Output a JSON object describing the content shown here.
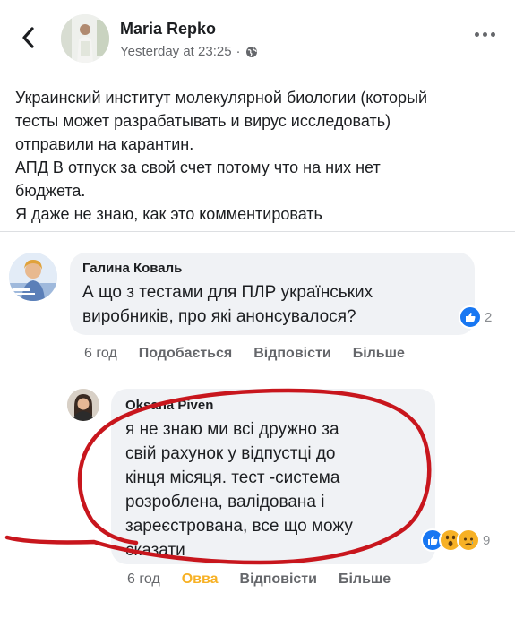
{
  "post": {
    "author": "Maria Repko",
    "time": "Yesterday at 23:25",
    "separator": "·",
    "text_lines": [
      "Украинский институт молекулярной биологии (который",
      "тесты может разрабатывать и вирус исследовать)",
      "отправили на карантин.",
      "АПД В отпуск за свой счет потому что на них нет",
      "бюджета.",
      "Я даже не знаю, как это комментировать"
    ]
  },
  "comments": [
    {
      "author": "Галина Коваль",
      "text_lines": [
        "А що з тестами для ПЛР українських",
        "виробників, про які анонсувалося?"
      ],
      "reaction_count": "2",
      "time": "6 год",
      "like": "Подобається",
      "reply": "Відповісти",
      "more": "Більше"
    },
    {
      "author": "Oksana Piven",
      "text_lines": [
        "я не знаю ми всі дружно за",
        "свій рахунок у відпустці до",
        "кінця місяця. тест -система",
        "розроблена, валідована і",
        "зареєстрована, все що можу",
        "сказати"
      ],
      "reaction_count": "9",
      "time": "6 год",
      "like": "Овва",
      "reply": "Відповісти",
      "more": "Більше"
    }
  ],
  "icons": {
    "back": "chevron-left-icon",
    "privacy": "globe-icon",
    "more": "more-dots-icon",
    "like": "like-reaction-icon",
    "wow": "wow-reaction-icon",
    "sad": "sad-reaction-icon"
  },
  "colors": {
    "like_blue": "#1877f2",
    "wow_yellow": "#f7b125",
    "annotation_red": "#c8161d",
    "bubble_gray": "#f0f2f5"
  }
}
